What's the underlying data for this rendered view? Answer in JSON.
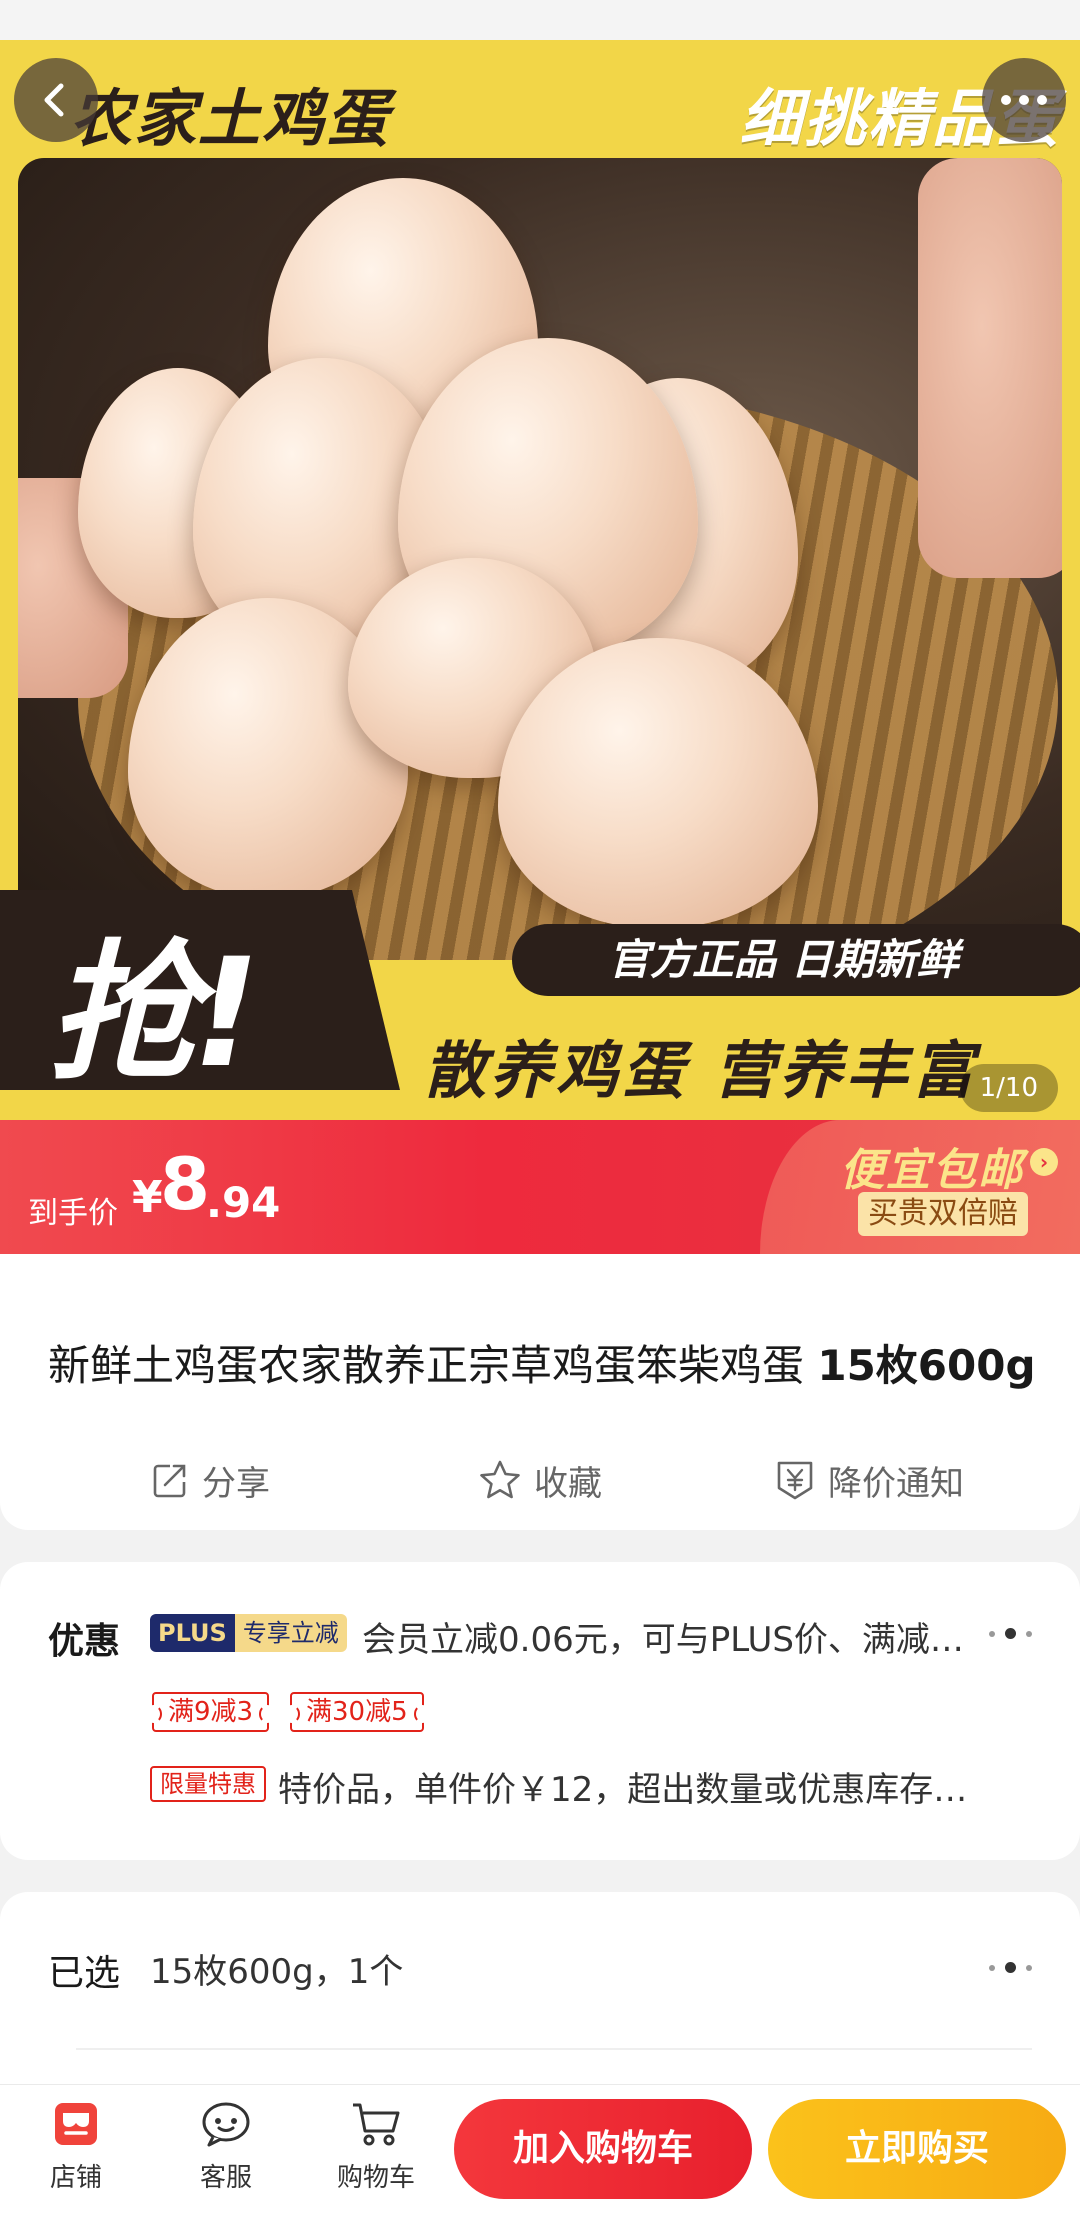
{
  "hero": {
    "title_left": "农家土鸡蛋",
    "title_right": "细挑精品蛋",
    "grab": "抢!",
    "tagline": "官方正品 日期新鲜",
    "subtitle": "散养鸡蛋 营养丰富",
    "image_counter": "1/10"
  },
  "price": {
    "label": "到手价",
    "currency": "¥",
    "integer": "8",
    "decimal": ".94",
    "promo_title": "便宜包邮",
    "promo_tag": "买贵双倍赔"
  },
  "product": {
    "title_main": "新鲜土鸡蛋农家散养正宗草鸡蛋笨柴鸡蛋 ",
    "title_spec": "15枚600g"
  },
  "actions": {
    "share": "分享",
    "favorite": "收藏",
    "price_alert": "降价通知"
  },
  "discount": {
    "label": "优惠",
    "plus_badge": "PLUS",
    "plus_badge_suffix": "专享立减",
    "plus_text": "会员立减0.06元，可与PLUS价、满减…",
    "coupons": [
      "满9减3",
      "满30减5"
    ],
    "limit_badge": "限量特惠",
    "limit_text": "特价品，单件价￥12，超出数量或优惠库存…"
  },
  "selected": {
    "label": "已选",
    "value": "15枚600g，1个"
  },
  "bottom": {
    "store": "店铺",
    "service": "客服",
    "cart": "购物车",
    "add_to_cart": "加入购物车",
    "buy_now": "立即购买"
  },
  "colors": {
    "accent_red": "#e63340",
    "buy_yellow": "#f7ab13",
    "hero_yellow": "#f2d648"
  }
}
